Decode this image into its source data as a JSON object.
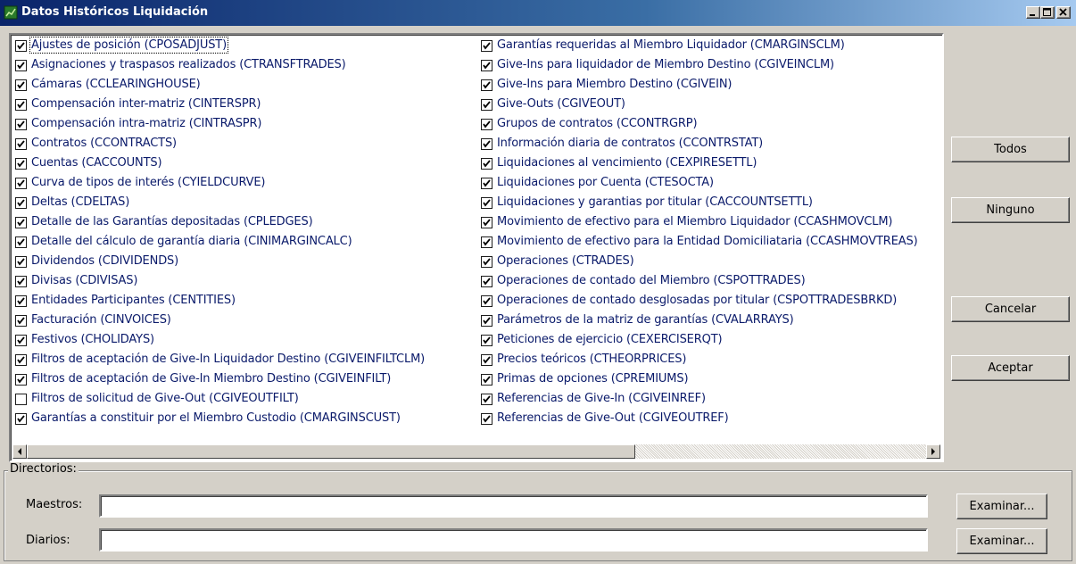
{
  "window": {
    "title": "Datos Históricos Liquidación",
    "icon": "app-icon",
    "controls": [
      "minimize",
      "maximize",
      "close"
    ]
  },
  "tables_col1": [
    {
      "label": "Ajustes de posición (CPOSADJUST)",
      "checked": true
    },
    {
      "label": "Asignaciones y traspasos realizados (CTRANSFTRADES)",
      "checked": true
    },
    {
      "label": "Cámaras (CCLEARINGHOUSE)",
      "checked": true
    },
    {
      "label": "Compensación inter-matriz (CINTERSPR)",
      "checked": true
    },
    {
      "label": "Compensación intra-matriz (CINTRASPR)",
      "checked": true
    },
    {
      "label": "Contratos (CCONTRACTS)",
      "checked": true
    },
    {
      "label": "Cuentas (CACCOUNTS)",
      "checked": true
    },
    {
      "label": "Curva de tipos de interés (CYIELDCURVE)",
      "checked": true
    },
    {
      "label": "Deltas (CDELTAS)",
      "checked": true
    },
    {
      "label": "Detalle de las Garantías depositadas (CPLEDGES)",
      "checked": true
    },
    {
      "label": "Detalle del cálculo de garantía diaria (CINIMARGINCALC)",
      "checked": true
    },
    {
      "label": "Dividendos (CDIVIDENDS)",
      "checked": true
    },
    {
      "label": "Divisas (CDIVISAS)",
      "checked": true
    },
    {
      "label": "Entidades Participantes (CENTITIES)",
      "checked": true
    },
    {
      "label": "Facturación (CINVOICES)",
      "checked": true
    },
    {
      "label": "Festivos (CHOLIDAYS)",
      "checked": true
    },
    {
      "label": "Filtros de aceptación de Give-In Liquidador Destino (CGIVEINFILTCLM)",
      "checked": true
    },
    {
      "label": "Filtros de aceptación de Give-In Miembro Destino (CGIVEINFILT)",
      "checked": true
    },
    {
      "label": "Filtros de solicitud de Give-Out (CGIVEOUTFILT)",
      "checked": false
    },
    {
      "label": "Garantías a constituir por el Miembro Custodio (CMARGINSCUST)",
      "checked": true
    }
  ],
  "tables_col2": [
    {
      "label": "Garantías requeridas al Miembro Liquidador (CMARGINSCLM)",
      "checked": true
    },
    {
      "label": "Give-Ins para liquidador de Miembro Destino (CGIVEINCLM)",
      "checked": true
    },
    {
      "label": "Give-Ins para Miembro Destino (CGIVEIN)",
      "checked": true
    },
    {
      "label": "Give-Outs (CGIVEOUT)",
      "checked": true
    },
    {
      "label": "Grupos de contratos (CCONTRGRP)",
      "checked": true
    },
    {
      "label": "Información diaria de contratos (CCONTRSTAT)",
      "checked": true
    },
    {
      "label": "Liquidaciones al vencimiento (CEXPIRESETTL)",
      "checked": true
    },
    {
      "label": "Liquidaciones por Cuenta (CTESOCTA)",
      "checked": true
    },
    {
      "label": "Liquidaciones y garantias por titular (CACCOUNTSETTL)",
      "checked": true
    },
    {
      "label": "Movimiento de efectivo para el Miembro Liquidador (CCASHMOVCLM)",
      "checked": true
    },
    {
      "label": "Movimiento de efectivo para la Entidad Domiciliataria (CCASHMOVTREAS)",
      "checked": true
    },
    {
      "label": "Operaciones (CTRADES)",
      "checked": true
    },
    {
      "label": "Operaciones de contado del Miembro (CSPOTTRADES)",
      "checked": true
    },
    {
      "label": "Operaciones de contado desglosadas por titular (CSPOTTRADESBRKD)",
      "checked": true
    },
    {
      "label": "Parámetros de la matriz de garantías (CVALARRAYS)",
      "checked": true
    },
    {
      "label": "Peticiones de ejercicio (CEXERCISERQT)",
      "checked": true
    },
    {
      "label": "Precios teóricos (CTHEORPRICES)",
      "checked": true
    },
    {
      "label": "Primas de opciones (CPREMIUMS)",
      "checked": true
    },
    {
      "label": "Referencias de Give-In (CGIVEINREF)",
      "checked": true
    },
    {
      "label": "Referencias de Give-Out (CGIVEOUTREF)",
      "checked": true
    }
  ],
  "buttons": {
    "todos": "Todos",
    "ninguno": "Ninguno",
    "cancelar": "Cancelar",
    "aceptar": "Aceptar"
  },
  "directories": {
    "legend": "Directorios:",
    "maestros_label": "Maestros:",
    "maestros_value": "",
    "diarios_label": "Diarios:",
    "diarios_value": "",
    "browse_label": "Examinar..."
  },
  "colors": {
    "title_bar": "#0a246a",
    "item_text": "#0a1a6a",
    "face": "#d4d0c8"
  }
}
